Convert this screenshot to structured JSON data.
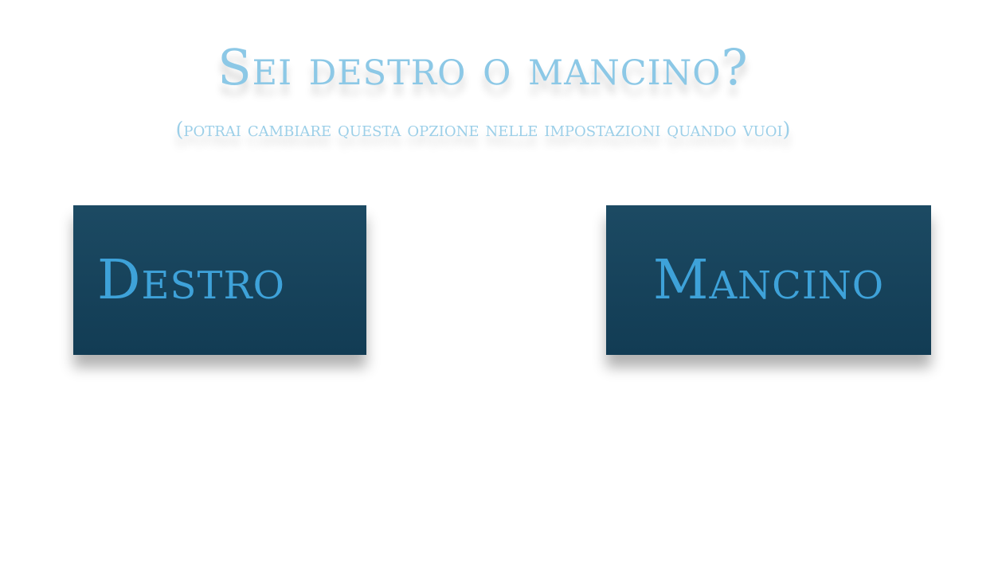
{
  "heading": {
    "title": "Sei destro o mancino?",
    "subtitle": "(potrai cambiare questa opzione nelle impostazioni quando vuoi)"
  },
  "choices": {
    "right_handed_label": "Destro",
    "left_handed_label": "Mancino"
  },
  "colors": {
    "title_text": "#8cc8e6",
    "button_background": "#123c54",
    "button_text": "#3ea2d9",
    "page_background": "#ffffff"
  }
}
